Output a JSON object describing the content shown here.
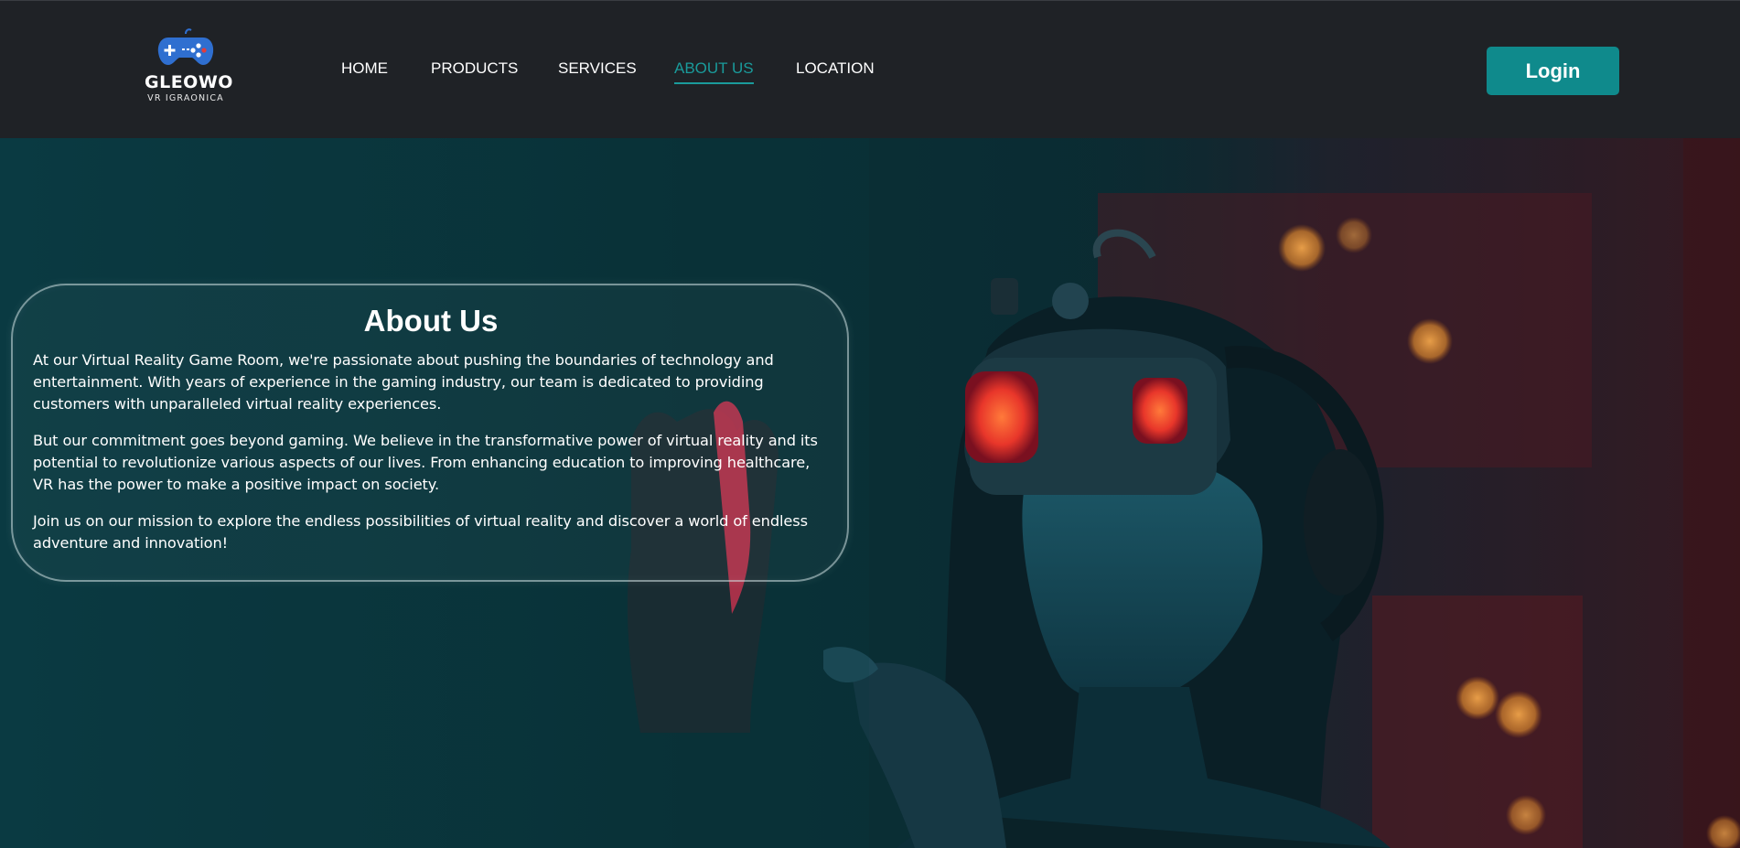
{
  "brand": {
    "name": "GLEOWO",
    "tagline": "VR IGRAONICA",
    "colors": {
      "accent": "#0f8a8c",
      "active_link": "#1a9b9b",
      "header_bg": "#1f2226"
    },
    "logo_icon": "gamepad-icon"
  },
  "nav": {
    "items": [
      {
        "label": "HOME",
        "active": false
      },
      {
        "label": "PRODUCTS",
        "active": false
      },
      {
        "label": "SERVICES",
        "active": false
      },
      {
        "label": "ABOUT US",
        "active": true
      },
      {
        "label": "LOCATION",
        "active": false
      }
    ]
  },
  "header": {
    "login_label": "Login"
  },
  "about": {
    "title": "About Us",
    "paragraphs": [
      "At our Virtual Reality Game Room, we're passionate about pushing the boundaries of technology and entertainment. With years of experience in the gaming industry, our team is dedicated to providing customers with unparalleled virtual reality experiences.",
      "But our commitment goes beyond gaming. We believe in the transformative power of virtual reality and its potential to revolutionize various aspects of our lives. From enhancing education to improving healthcare, VR has the power to make a positive impact on society.",
      "Join us on our mission to explore the endless possibilities of virtual reality and discover a world of endless adventure and innovation!"
    ]
  }
}
